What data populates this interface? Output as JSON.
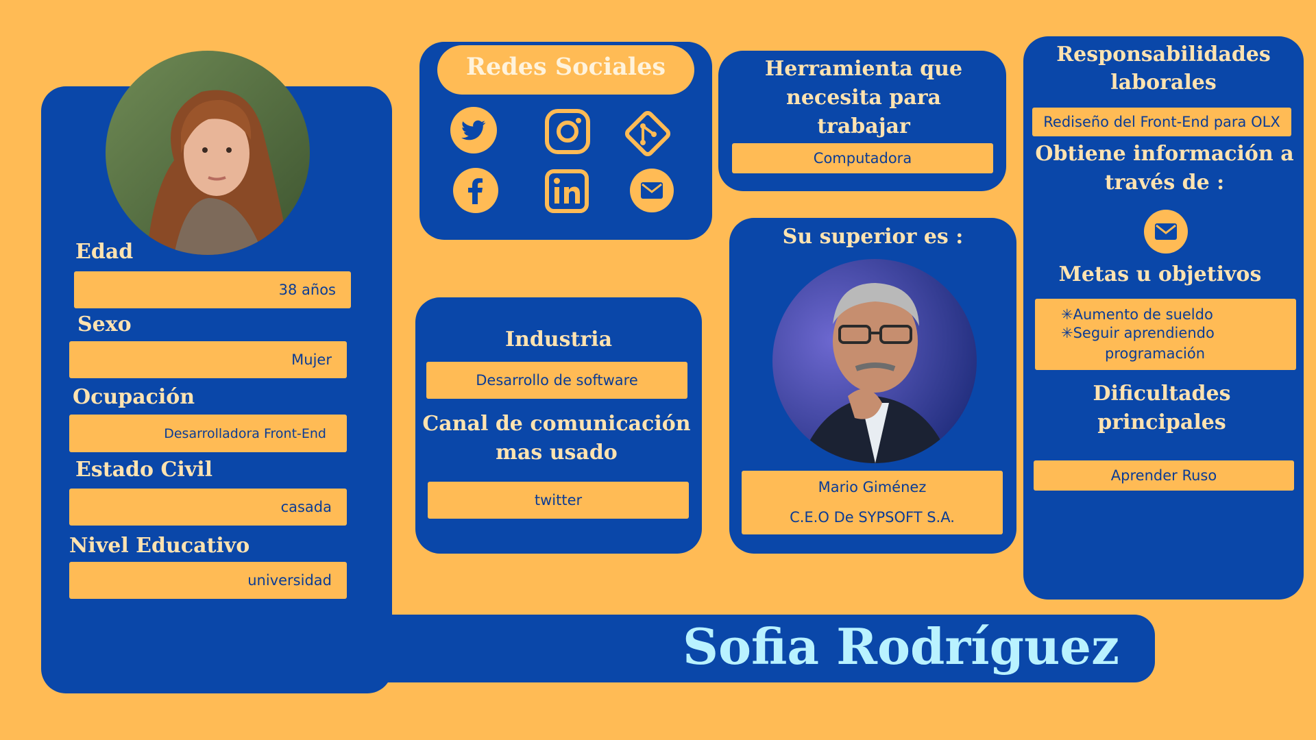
{
  "colors": {
    "background": "#ffbb55",
    "panel": "#0a47a9",
    "field": "#ffbb55",
    "heading": "#ffe3b0",
    "name": "#b9f2ff",
    "fieldText": "#0a3b95"
  },
  "profile": {
    "photo": "woman-portrait",
    "age_label": "Edad",
    "age_value": "38 años",
    "sex_label": "Sexo",
    "sex_value": "Mujer",
    "occupation_label": "Ocupación",
    "occupation_value": "Desarrolladora Front-End",
    "civil_label": "Estado Civil",
    "civil_value": "casada",
    "education_label": "Nivel Educativo",
    "education_value": "universidad"
  },
  "social": {
    "title": "Redes Sociales",
    "icons": [
      "twitter-icon",
      "instagram-icon",
      "git-icon",
      "facebook-icon",
      "linkedin-icon",
      "mail-icon"
    ]
  },
  "industry": {
    "title": "Industria",
    "value": "Desarrollo de software",
    "channel_title": "Canal de comunicación mas usado",
    "channel_value": "twitter"
  },
  "tool": {
    "title": "Herramienta que necesita para trabajar",
    "value": "Computadora"
  },
  "superior": {
    "title": "Su superior es :",
    "photo": "man-portrait",
    "name": "Mario Giménez",
    "role": "C.E.O De SYPSOFT S.A."
  },
  "responsibilities": {
    "title": "Responsabilidades laborales",
    "value": "Rediseño del Front-End para OLX",
    "info_title": "Obtiene información a través de :",
    "info_icon": "mail-icon",
    "goals_title": "Metas u objetivos",
    "goal_1": "✳Aumento de sueldo",
    "goal_2": "✳Seguir aprendiendo",
    "goal_2b": "programación",
    "difficulties_title": "Dificultades principales",
    "difficulty": "Aprender Ruso"
  },
  "name": "Sofia Rodríguez"
}
